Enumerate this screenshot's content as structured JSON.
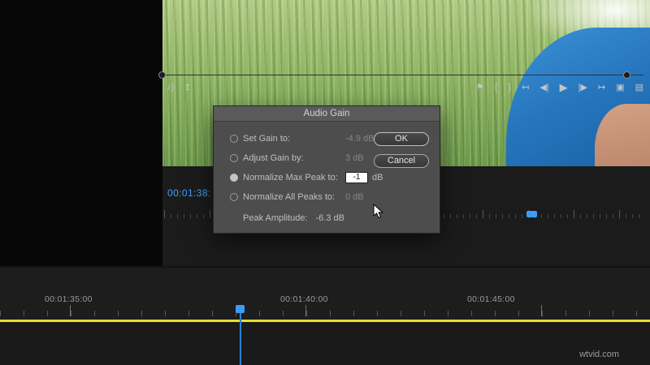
{
  "monitor": {
    "timecode": "00:01:38:",
    "left_icons": [
      {
        "name": "audio-meters-icon",
        "glyph": "♪)"
      },
      {
        "name": "export-frame-icon",
        "glyph": "↥"
      }
    ],
    "transport": [
      {
        "name": "add-marker-icon",
        "glyph": "⚑"
      },
      {
        "name": "mark-in-icon",
        "glyph": "{"
      },
      {
        "name": "mark-out-icon",
        "glyph": "}"
      },
      {
        "name": "go-to-in-icon",
        "glyph": "↤"
      },
      {
        "name": "step-back-icon",
        "glyph": "◀|"
      },
      {
        "name": "play-icon",
        "glyph": "▶"
      },
      {
        "name": "step-forward-icon",
        "glyph": "|▶"
      },
      {
        "name": "go-to-out-icon",
        "glyph": "↦"
      },
      {
        "name": "lift-icon",
        "glyph": "▣"
      },
      {
        "name": "extract-icon",
        "glyph": "▤"
      }
    ]
  },
  "dialog": {
    "title": "Audio Gain",
    "options": [
      {
        "label": "Set Gain to:",
        "value": "-4.9 dB",
        "selected": false
      },
      {
        "label": "Adjust Gain by:",
        "value": "3 dB",
        "selected": false
      },
      {
        "label": "Normalize Max Peak to:",
        "value": "-1",
        "unit": "dB",
        "selected": true
      },
      {
        "label": "Normalize All Peaks to:",
        "value": "0 dB",
        "selected": false
      }
    ],
    "peak_amplitude_label": "Peak Amplitude:",
    "peak_amplitude_value": "-6.3 dB",
    "buttons": {
      "ok": "OK",
      "cancel": "Cancel"
    }
  },
  "timeline": {
    "tick_labels": [
      "00:01:35:00",
      "00:01:40:00",
      "00:01:45:00"
    ]
  },
  "watermark": "wtvid.com",
  "colors": {
    "accent_blue": "#3e9bf4",
    "timecode_blue": "#3ea0ff",
    "work_area_yellow": "#e6df2e"
  }
}
